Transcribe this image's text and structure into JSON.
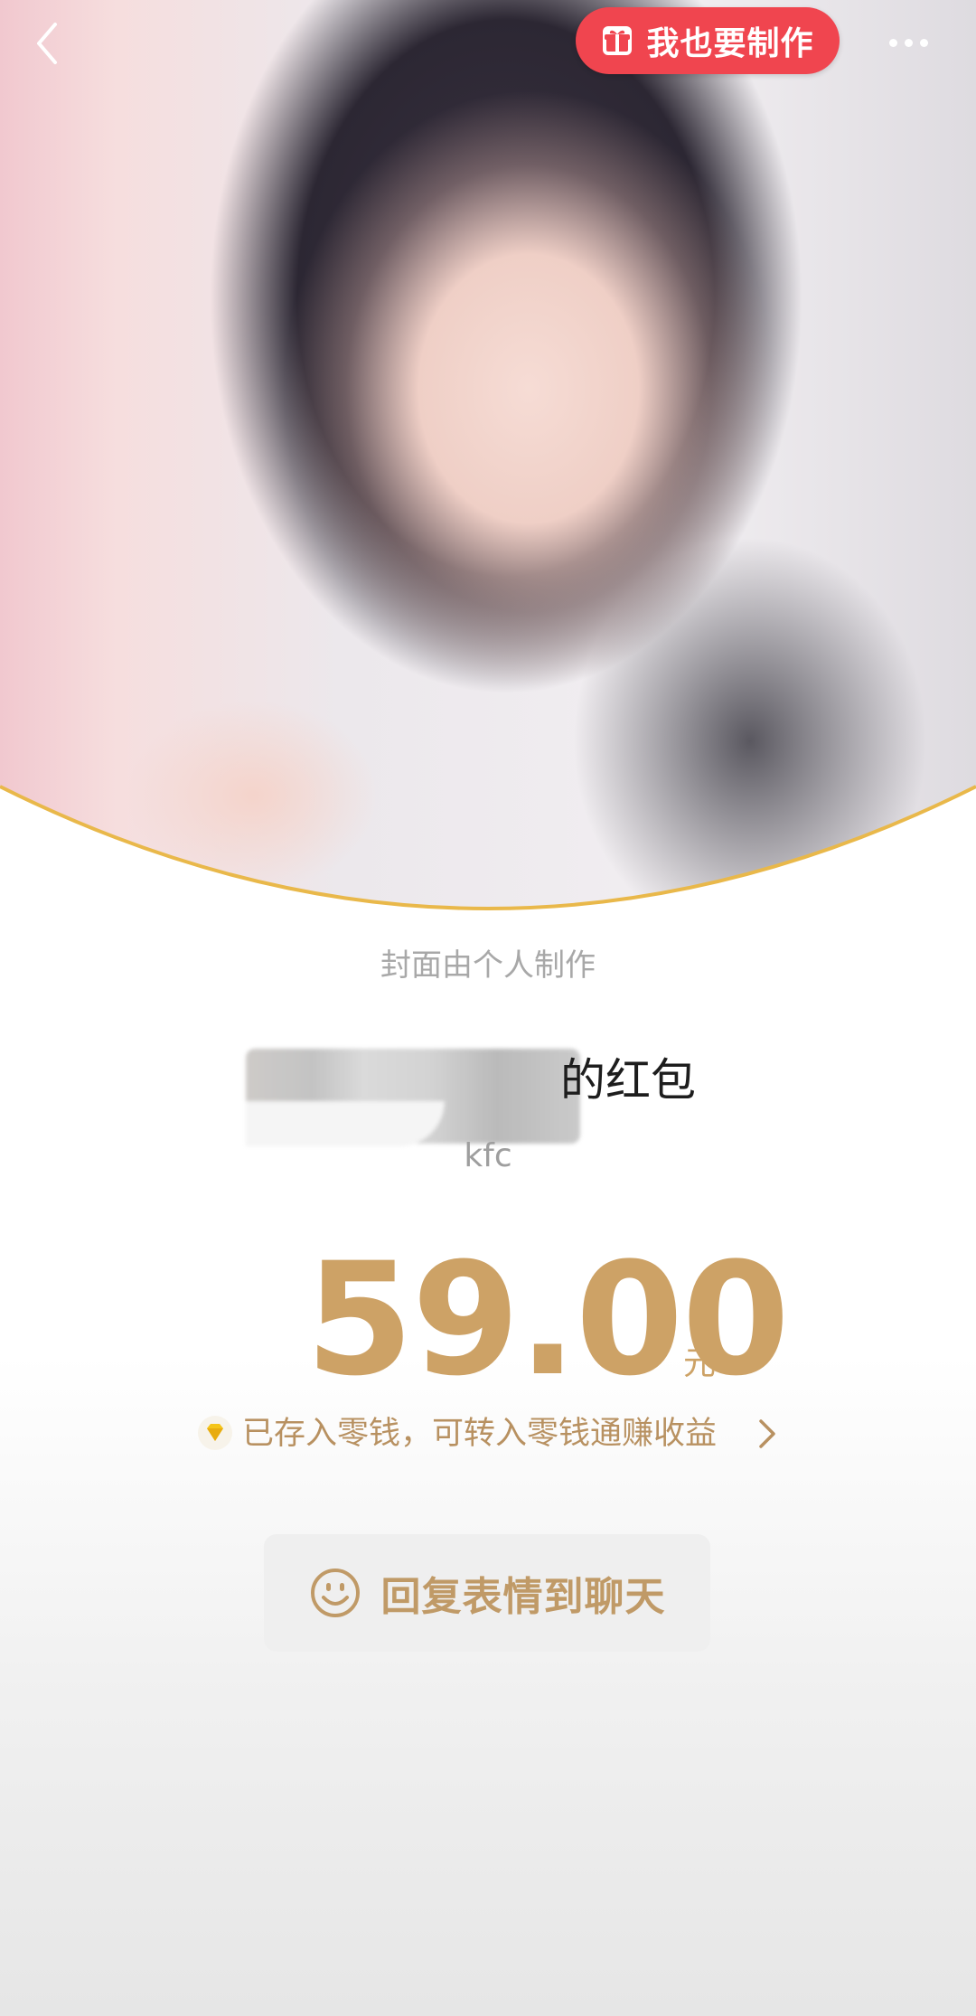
{
  "header": {
    "make_label": "我也要制作"
  },
  "cover": {
    "note": "封面由个人制作"
  },
  "sender": {
    "suffix": "的红包"
  },
  "remark": "kfc",
  "amount": {
    "value": "59.00",
    "unit": "元"
  },
  "wallet": {
    "text": "已存入零钱，可转入零钱通赚收益"
  },
  "reply": {
    "label": "回复表情到聊天"
  },
  "colors": {
    "accent_gold": "#cda266",
    "make_button": "#f0454f",
    "curve_gold": "#e9b84a"
  },
  "icons": [
    "back-arrow-icon",
    "gift-icon",
    "more-dots-icon",
    "diamond-icon",
    "chevron-right-icon",
    "smile-icon"
  ]
}
